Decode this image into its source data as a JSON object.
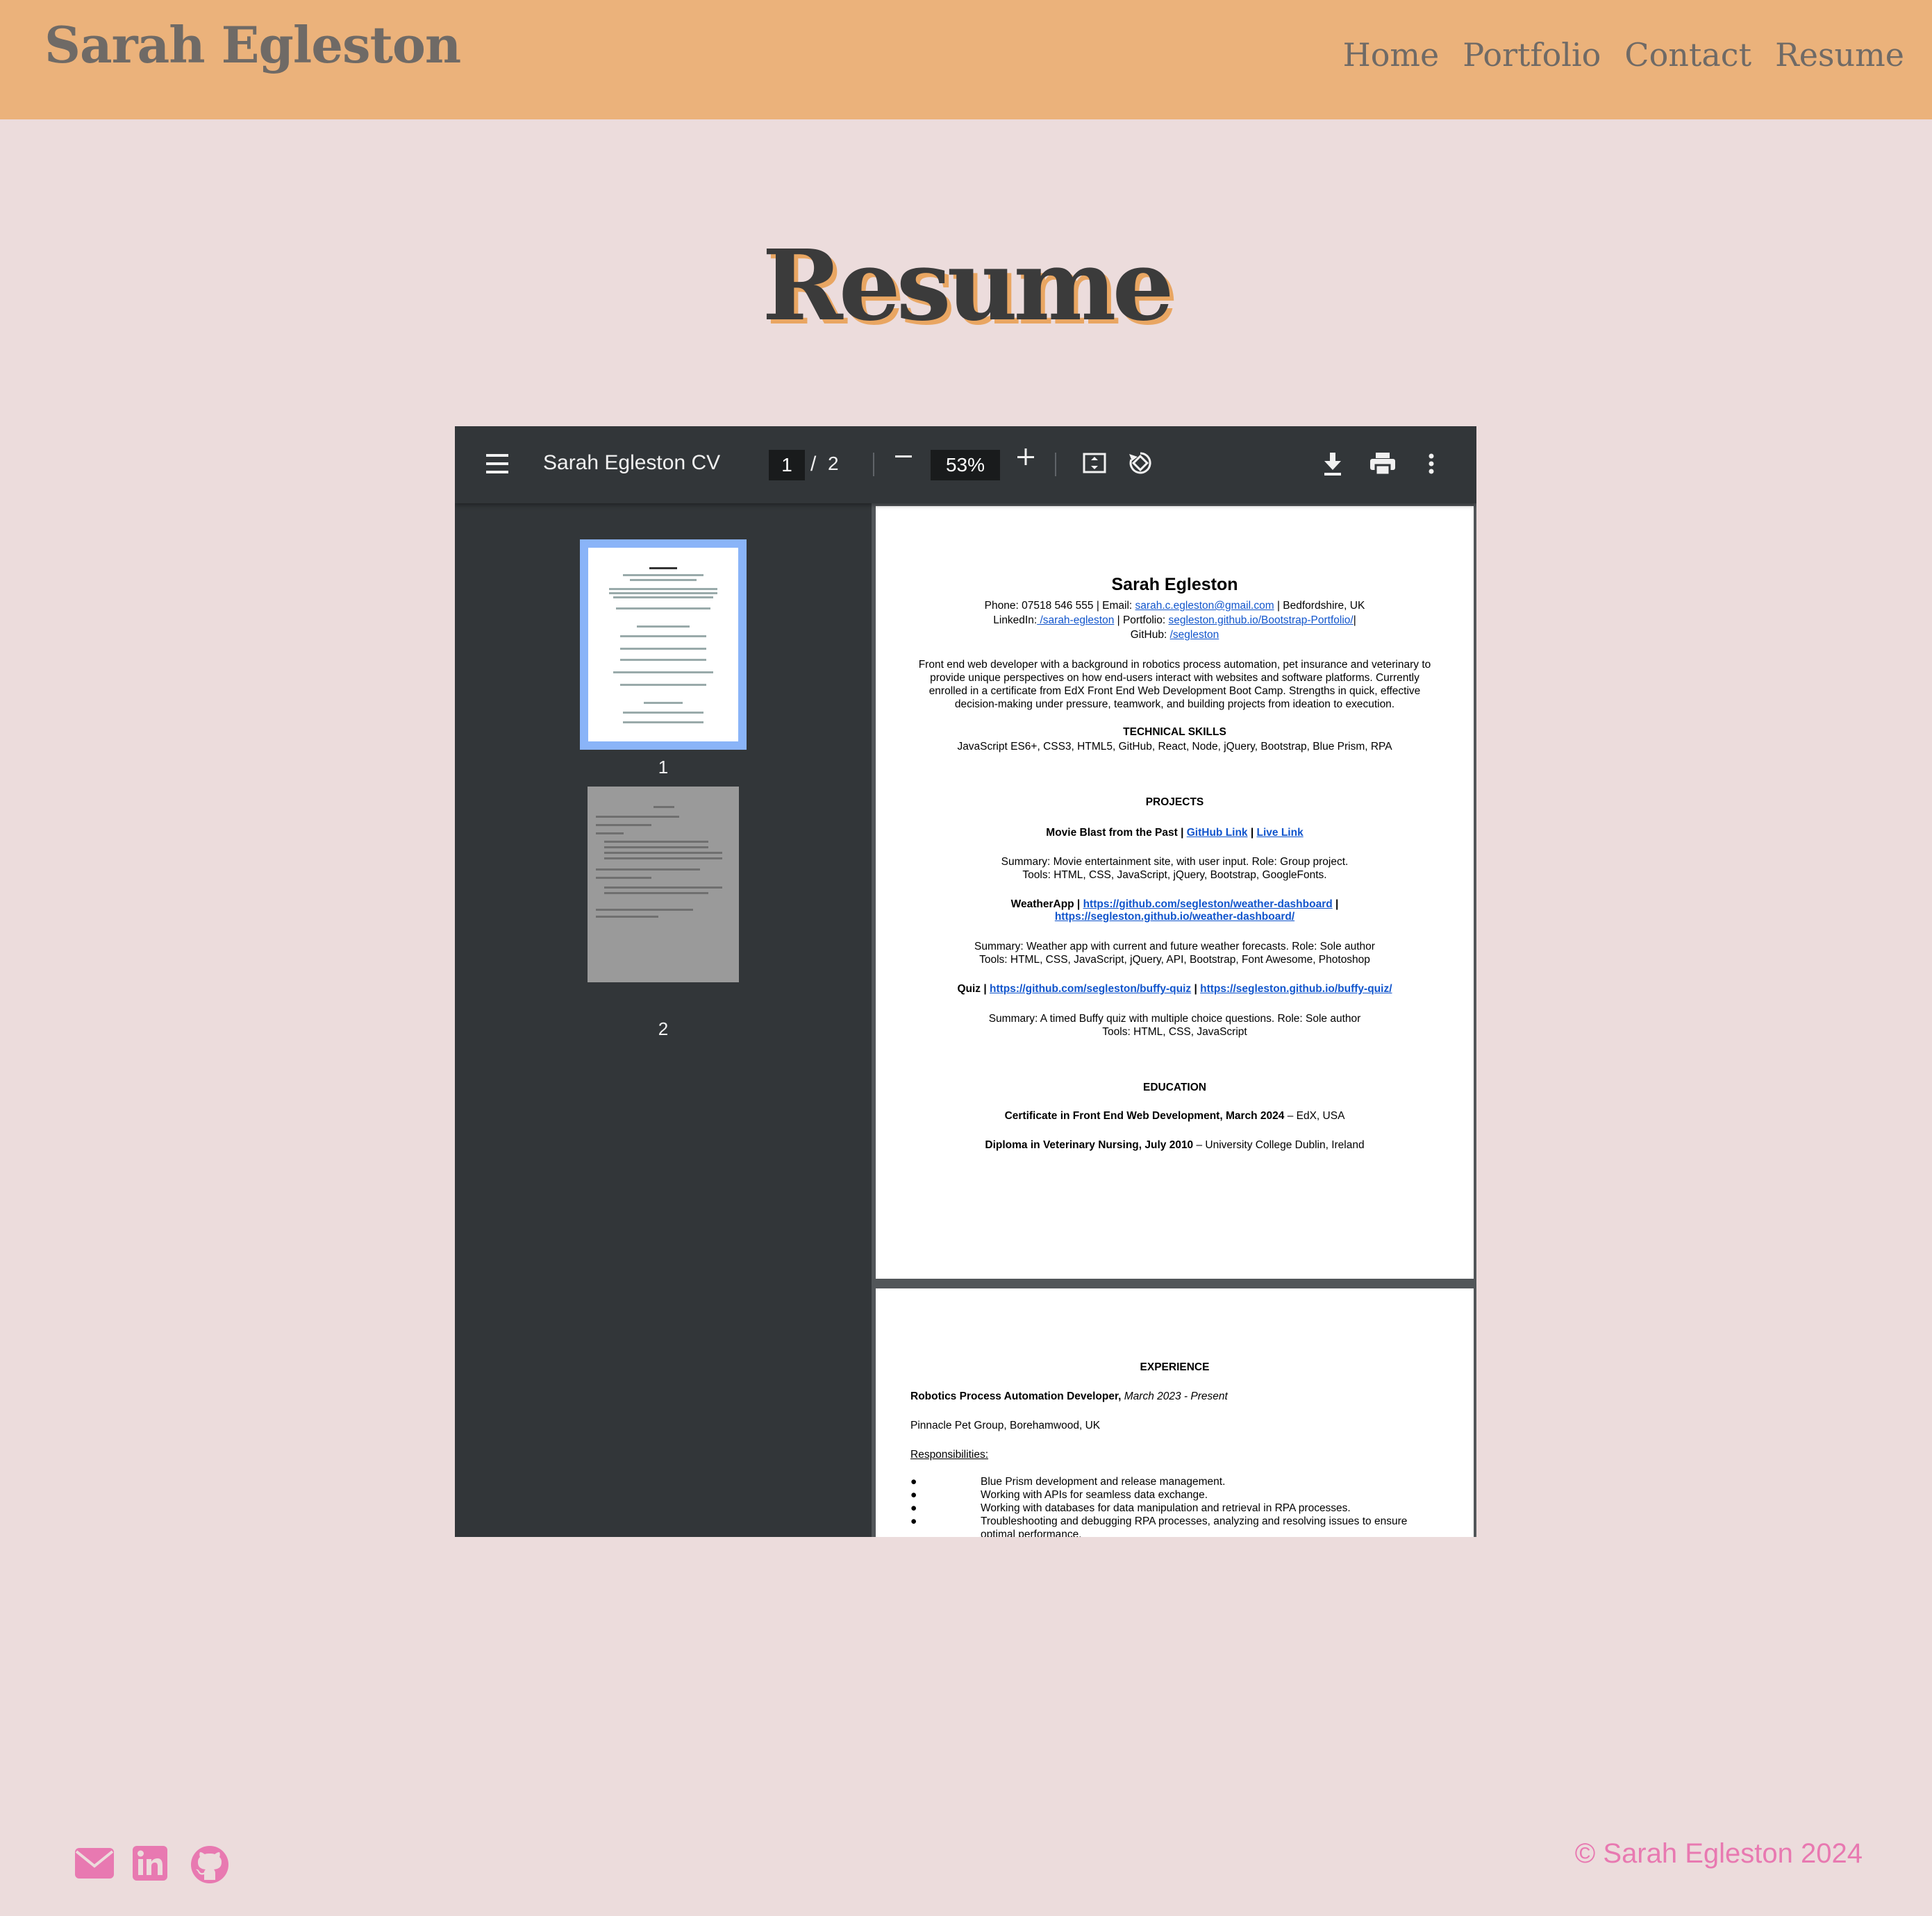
{
  "header": {
    "brand": "Sarah Egleston",
    "nav": [
      "Home",
      "Portfolio",
      "Contact",
      "Resume"
    ]
  },
  "page_title": "Resume",
  "viewer": {
    "doc_title": "Sarah Egleston CV",
    "current_page": "1",
    "page_sep": "/",
    "total_pages": "2",
    "zoom": "53%",
    "thumb_labels": [
      "1",
      "2"
    ]
  },
  "cv": {
    "name": "Sarah Egleston",
    "contact_line1_pre": "Phone: 07518 546 555 | Email: ",
    "email": "sarah.c.egleston@gmail.com",
    "contact_line1_post": " | Bedfordshire, UK",
    "linkedin_label": "LinkedIn:",
    "linkedin": " /sarah-egleston",
    "portfolio_label": " | Portfolio: ",
    "portfolio": "segleston.github.io/Bootstrap-Portfolio/",
    "portfolio_post": "|",
    "github_label": "GitHub: ",
    "github": "/segleston",
    "summary": [
      "Front end web developer with a background in robotics process automation, pet insurance and veterinary to",
      "provide unique perspectives on how end-users interact with websites and software platforms. Currently",
      "enrolled in a certificate from EdX Front End Web Development Boot Camp. Strengths in quick, effective",
      "decision-making under pressure, teamwork, and building projects from ideation to execution."
    ],
    "skills_heading": "TECHNICAL SKILLS",
    "skills": "JavaScript ES6+, CSS3, HTML5, GitHub, React, Node, jQuery, Bootstrap, Blue Prism, RPA",
    "projects_heading": "PROJECTS",
    "p1_title": "Movie Blast from the Past | ",
    "p1_link1": "GitHub Link",
    "p1_sep": " | ",
    "p1_link2": "Live Link",
    "p1_summary": "Summary: Movie entertainment site, with user input. Role: Group project.",
    "p1_tools": "Tools: HTML, CSS, JavaScript, jQuery, Bootstrap, GoogleFonts.",
    "p2_title": "WeatherApp | ",
    "p2_link1": "https://github.com/segleston/weather-dashboard",
    "p2_sep": " |",
    "p2_link2": "https://segleston.github.io/weather-dashboard/",
    "p2_summary": "Summary: Weather app with current and future weather forecasts. Role: Sole author",
    "p2_tools": "Tools: HTML, CSS, JavaScript, jQuery, API, Bootstrap, Font Awesome, Photoshop",
    "p3_title": "Quiz | ",
    "p3_link1": "https://github.com/segleston/buffy-quiz",
    "p3_sep": " | ",
    "p3_link2": "https://segleston.github.io/buffy-quiz/",
    "p3_summary": "Summary: A timed Buffy quiz with multiple choice questions. Role: Sole author",
    "p3_tools": "Tools: HTML, CSS, JavaScript",
    "education_heading": "EDUCATION",
    "edu1_bold": "Certificate in Front End Web Development, March 2024",
    "edu1_rest": " – EdX, USA",
    "edu2_bold": "Diploma in Veterinary Nursing, July 2010",
    "edu2_rest": " – University College Dublin, Ireland",
    "experience_heading": "EXPERIENCE",
    "job_title": "Robotics Process Automation Developer,",
    "job_dates": " March 2023 - Present",
    "job_company": "Pinnacle Pet Group, Borehamwood, UK",
    "responsibilities_label": "Responsibilities:",
    "bullet": "●",
    "responsibilities": [
      "Blue Prism development and release management.",
      "Working with APIs for seamless data exchange.",
      "Working with databases for data manipulation and retrieval in RPA processes.",
      "Troubleshooting and debugging RPA processes, analyzing and resolving issues to ensure",
      "optimal performance."
    ]
  },
  "footer": {
    "icons": [
      "envelope-icon",
      "linkedin-icon",
      "github-icon"
    ],
    "copyright": "© Sarah Egleston 2024"
  },
  "colors": {
    "header_bg": "#ebb27b",
    "page_bg": "#ecdcdc",
    "brand_text": "#6f6a66",
    "title_shadow": "#e9a662",
    "footer_accent": "#e879b1",
    "viewer_bg": "#323639"
  }
}
